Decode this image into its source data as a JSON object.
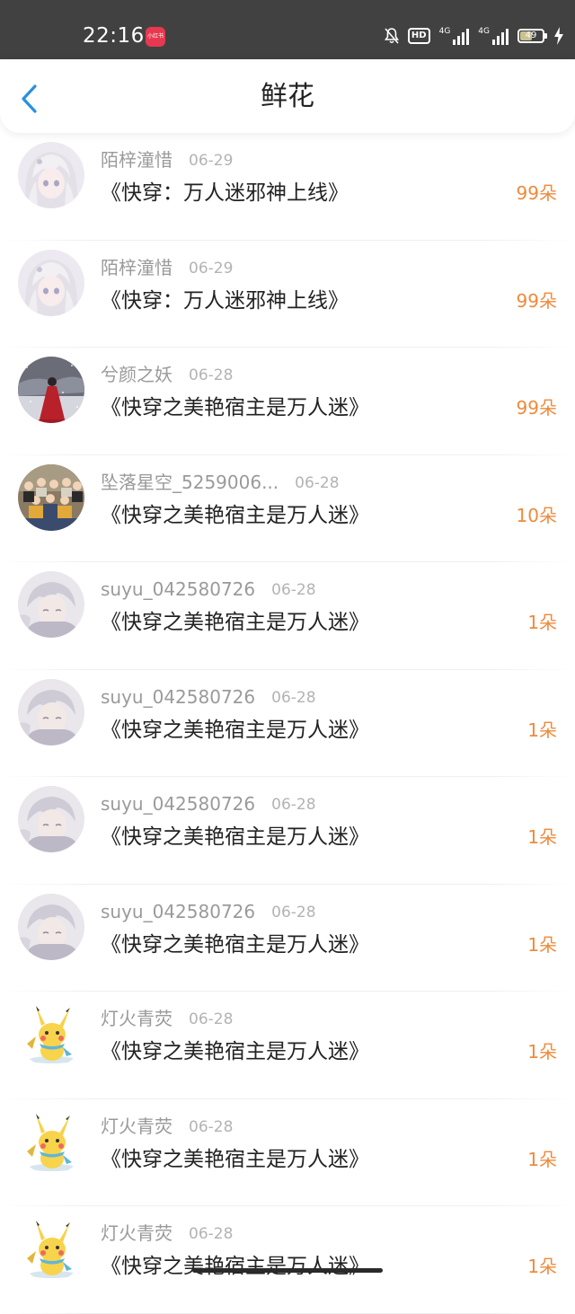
{
  "status_bar": {
    "time": "22:16",
    "app_badge": "小红书",
    "hd_label": "HD",
    "network_1": "4G",
    "network_2": "4G",
    "battery_level": "49",
    "icons": [
      "bell-muted-icon",
      "hd-icon",
      "signal-icon",
      "signal-icon",
      "battery-icon",
      "charging-bolt-icon"
    ]
  },
  "header": {
    "title": "鲜花",
    "back_icon": "chevron-left-icon",
    "accent_color": "#2a8fe0"
  },
  "colors": {
    "flower_count": "#ef8a3c",
    "username": "#9a9a9a",
    "date": "#b3b3b3"
  },
  "records": [
    {
      "user": "陌梓潼惜",
      "date": "06-29",
      "book": "《快穿：万人迷邪神上线》",
      "flowers": "99朵",
      "avatar": "anime-girl-avatar"
    },
    {
      "user": "陌梓潼惜",
      "date": "06-29",
      "book": "《快穿：万人迷邪神上线》",
      "flowers": "99朵",
      "avatar": "anime-girl-avatar"
    },
    {
      "user": "兮颜之妖",
      "date": "06-28",
      "book": "《快穿之美艳宿主是万人迷》",
      "flowers": "99朵",
      "avatar": "red-dress-avatar"
    },
    {
      "user": "坠落星空_5259006...",
      "date": "06-28",
      "book": "《快穿之美艳宿主是万人迷》",
      "flowers": "10朵",
      "avatar": "group-photo-avatar"
    },
    {
      "user": "suyu_042580726",
      "date": "06-28",
      "book": "《快穿之美艳宿主是万人迷》",
      "flowers": "1朵",
      "avatar": "anime-boy-avatar"
    },
    {
      "user": "suyu_042580726",
      "date": "06-28",
      "book": "《快穿之美艳宿主是万人迷》",
      "flowers": "1朵",
      "avatar": "anime-boy-avatar"
    },
    {
      "user": "suyu_042580726",
      "date": "06-28",
      "book": "《快穿之美艳宿主是万人迷》",
      "flowers": "1朵",
      "avatar": "anime-boy-avatar"
    },
    {
      "user": "suyu_042580726",
      "date": "06-28",
      "book": "《快穿之美艳宿主是万人迷》",
      "flowers": "1朵",
      "avatar": "anime-boy-avatar"
    },
    {
      "user": "灯火青荧",
      "date": "06-28",
      "book": "《快穿之美艳宿主是万人迷》",
      "flowers": "1朵",
      "avatar": "pikachu-avatar"
    },
    {
      "user": "灯火青荧",
      "date": "06-28",
      "book": "《快穿之美艳宿主是万人迷》",
      "flowers": "1朵",
      "avatar": "pikachu-avatar"
    },
    {
      "user": "灯火青荧",
      "date": "06-28",
      "book": "《快穿之美艳宿主是万人迷》",
      "flowers": "1朵",
      "avatar": "pikachu-avatar"
    }
  ]
}
